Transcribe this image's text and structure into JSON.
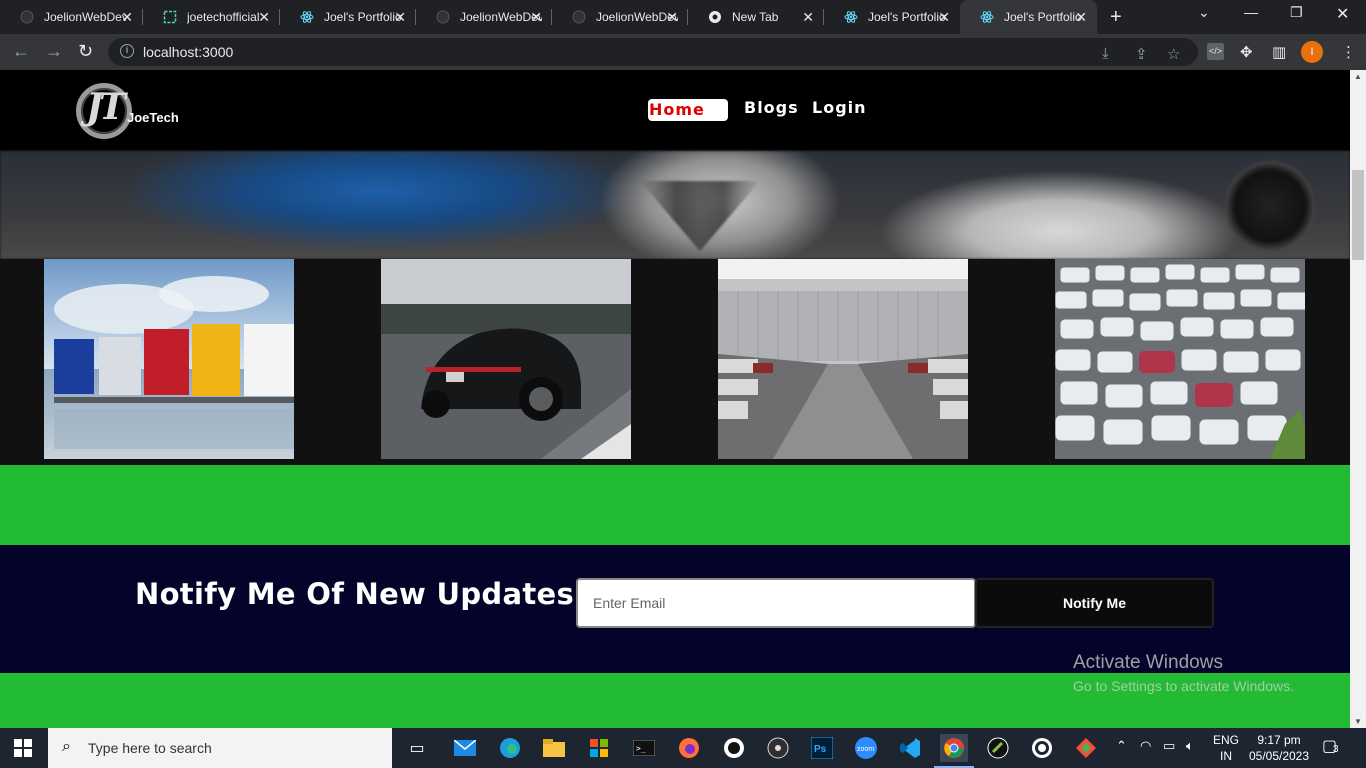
{
  "browser": {
    "tabs": [
      {
        "title": "JoelionWebDev",
        "icon": "github-icon"
      },
      {
        "title": "joetechofficial",
        "icon": "codesandbox-icon"
      },
      {
        "title": "Joel's Portfolio",
        "icon": "react-icon"
      },
      {
        "title": "JoelionWebDev",
        "icon": "github-icon"
      },
      {
        "title": "JoelionWebDev",
        "icon": "github-icon"
      },
      {
        "title": "New Tab",
        "icon": "chrome-icon"
      },
      {
        "title": "Joel's Portfolio",
        "icon": "react-icon"
      },
      {
        "title": "Joel's Portfolio",
        "icon": "react-icon"
      }
    ],
    "active_tab_index": 7,
    "url": "localhost:3000",
    "profile_initial": "I",
    "profile_color": "#e8710a"
  },
  "site": {
    "logo_initials": "JT",
    "logo_name": "JoeTech",
    "nav": {
      "home": "Home",
      "blogs": "Blogs",
      "login": "Login"
    },
    "accent_green": "#22bb33",
    "newsletter": {
      "heading": "Notify Me Of New Updates",
      "email_placeholder": "Enter Email",
      "button_label": "Notify Me",
      "background": "#04042a"
    }
  },
  "watermark": {
    "line1": "Activate Windows",
    "line2": "Go to Settings to activate Windows."
  },
  "taskbar": {
    "search_placeholder": "Type here to search",
    "language_line1": "ENG",
    "language_line2": "IN",
    "time": "9:17 pm",
    "date": "05/05/2023",
    "notification_count": "3",
    "apps": [
      "task-view",
      "mail",
      "edge",
      "file-explorer",
      "store",
      "terminal",
      "firefox",
      "obs-like",
      "obs",
      "photoshop",
      "zoom",
      "vscode",
      "chrome",
      "inkscape",
      "whatsapp",
      "git"
    ]
  }
}
